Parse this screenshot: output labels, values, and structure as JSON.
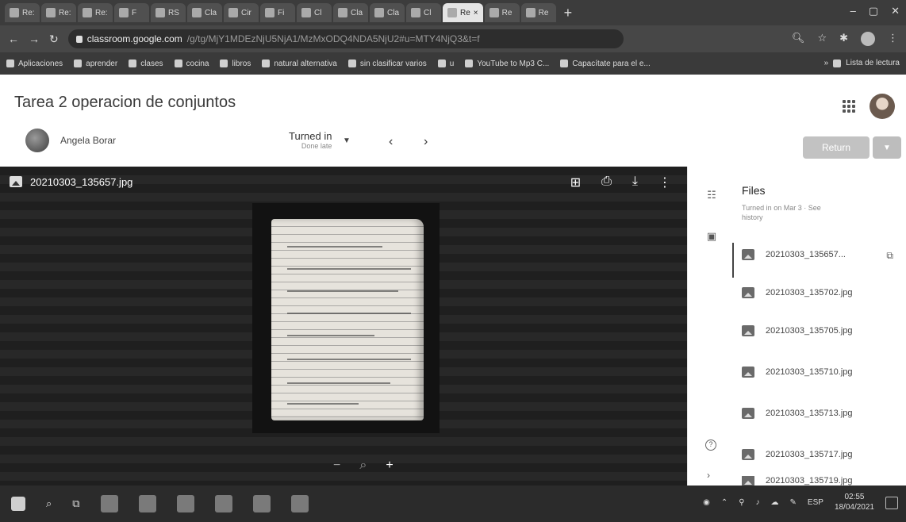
{
  "browser": {
    "tabs": [
      "Re:",
      "Re:",
      "Re:",
      "F",
      "RS",
      "Cla",
      "Cir",
      "Fi",
      "Cl",
      "Cla",
      "Cla",
      "Cl",
      "Re",
      "Re",
      "Re"
    ],
    "new_tab": "+",
    "url_domain": "classroom.google.com",
    "url_path": "/g/tg/MjY1MDEzNjU5NjA1/MzMxODQ4NDA5NjU2#u=MTY4NjQ3&t=f",
    "bookmarks": [
      "Aplicaciones",
      "aprender",
      "clases",
      "cocina",
      "libros",
      "natural alternativa",
      "sin clasificar varios",
      "u",
      "YouTube to Mp3 C...",
      "Capacítate para el e..."
    ],
    "reading_list": "Lista de lectura"
  },
  "assignment": {
    "title": "Tarea 2 operacion de conjuntos",
    "student_name": "Angela Borar",
    "status": "Turned in",
    "status_sub": "Done late",
    "return_label": "Return"
  },
  "viewer": {
    "file_name": "20210303_135657.jpg",
    "zoom_out": "−",
    "zoom_in": "+"
  },
  "files_panel": {
    "heading": "Files",
    "subtext": "Turned in on Mar 3 · See history",
    "files": [
      "20210303_135657...",
      "20210303_135702.jpg",
      "20210303_135705.jpg",
      "20210303_135710.jpg",
      "20210303_135713.jpg",
      "20210303_135717.jpg",
      "20210303_135719.jpg"
    ]
  },
  "taskbar": {
    "language": "ESP",
    "time": "02:55",
    "date": "18/04/2021"
  }
}
